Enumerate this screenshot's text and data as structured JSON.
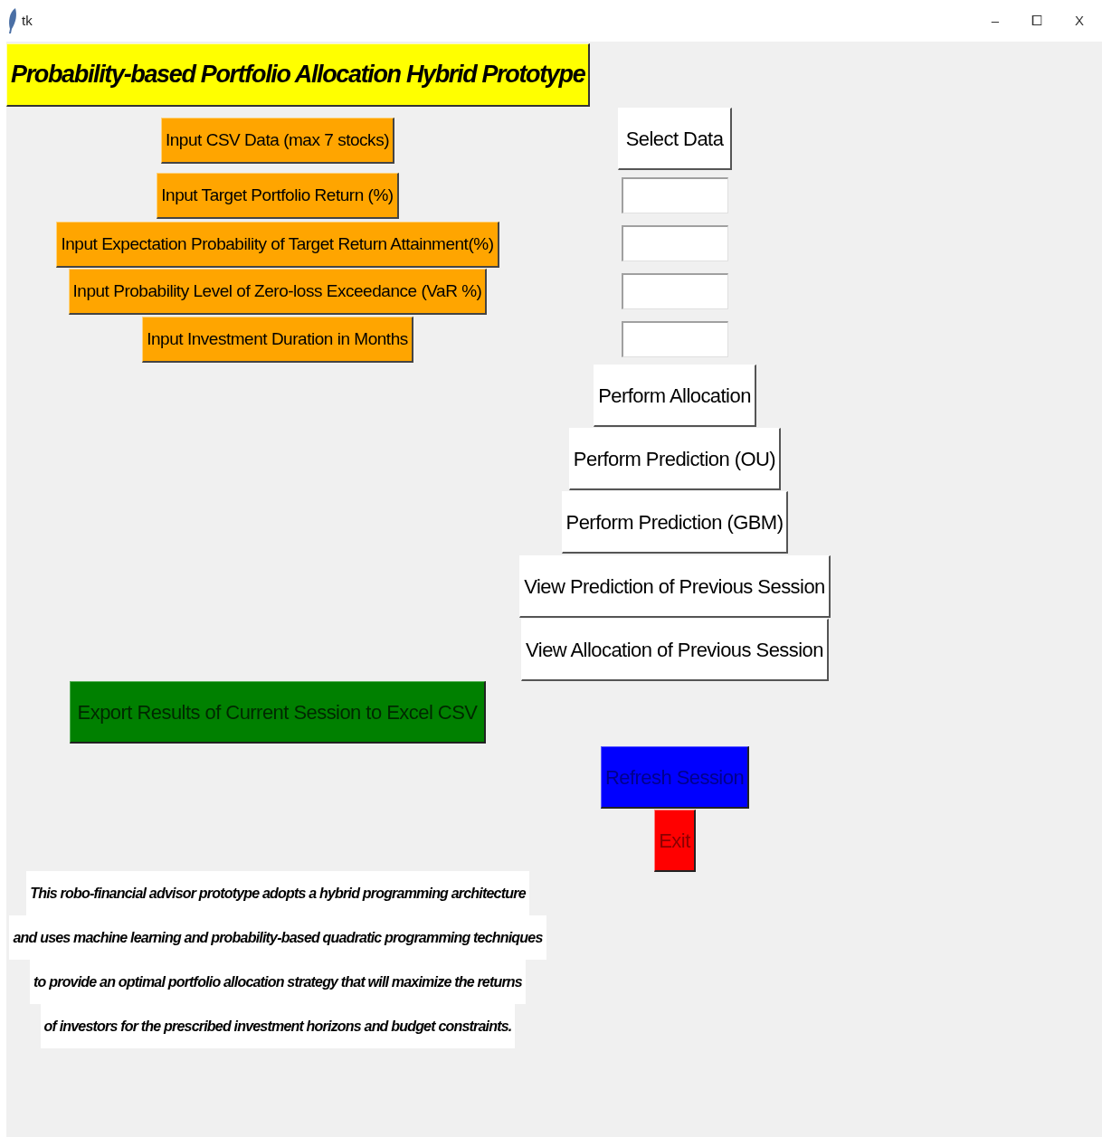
{
  "window": {
    "title": "tk",
    "controls": [
      "–",
      "⧠",
      "X"
    ]
  },
  "header": {
    "title": "Probability-based Portfolio Allocation Hybrid Prototype"
  },
  "input_labels": [
    "Input CSV Data (max 7 stocks)",
    "Input Target Portfolio Return (%)",
    "Input Expectation Probability of Target Return Attainment(%)",
    "Input Probability Level of Zero-loss Exceedance (VaR %)",
    "Input Investment Duration in Months"
  ],
  "select_button": {
    "label": "Select Data"
  },
  "entry_fields": [
    {
      "kind": "entry"
    },
    {
      "kind": "entry"
    },
    {
      "kind": "entry"
    },
    {
      "kind": "entry"
    }
  ],
  "actions": [
    {
      "label": "Perform Allocation",
      "kind": "plain"
    },
    {
      "label": "Perform Prediction (OU)",
      "kind": "plain"
    },
    {
      "label": "Perform Prediction (GBM)",
      "kind": "plain"
    },
    {
      "label": "View Prediction of Previous Session",
      "kind": "plain"
    },
    {
      "label": "View Allocation of Previous Session",
      "kind": "plain"
    },
    {
      "label": "Refresh Session",
      "kind": "refresh"
    },
    {
      "label": "Exit",
      "kind": "exit"
    }
  ],
  "export_button": {
    "label": "Export Results of Current Session to Excel CSV"
  },
  "description_lines": [
    "This robo-financial advisor prototype adopts a hybrid programming architecture",
    "and uses machine learning and probability-based quadratic programming techniques",
    "to provide an optimal portfolio allocation strategy that will maximize the returns",
    "of investors for the prescribed investment horizons and budget constraints."
  ]
}
